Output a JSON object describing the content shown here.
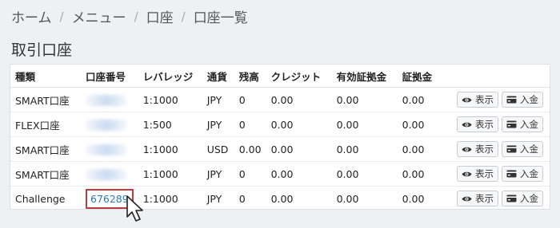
{
  "breadcrumb": {
    "items": [
      "ホーム",
      "メニュー",
      "口座",
      "口座一覧"
    ],
    "separator": "/"
  },
  "page_title": "取引口座",
  "table": {
    "headers": [
      "種類",
      "口座番号",
      "レバレッジ",
      "通貨",
      "残高",
      "クレジット",
      "有効証拠金",
      "証拠金"
    ],
    "rows": [
      {
        "type": "SMART口座",
        "account": "",
        "leverage": "1:1000",
        "currency": "JPY",
        "balance": "0",
        "credit": "0.00",
        "equity": "0.00",
        "margin": "0.00"
      },
      {
        "type": "FLEX口座",
        "account": "",
        "leverage": "1:500",
        "currency": "JPY",
        "balance": "0",
        "credit": "0.00",
        "equity": "0.00",
        "margin": "0.00"
      },
      {
        "type": "SMART口座",
        "account": "",
        "leverage": "1:1000",
        "currency": "USD",
        "balance": "0.00",
        "credit": "0.00",
        "equity": "0.00",
        "margin": "0.00"
      },
      {
        "type": "SMART口座",
        "account": "",
        "leverage": "1:1000",
        "currency": "JPY",
        "balance": "0",
        "credit": "0.00",
        "equity": "0.00",
        "margin": "0.00"
      },
      {
        "type": "Challenge",
        "account": "676289",
        "leverage": "1:1000",
        "currency": "JPY",
        "balance": "0",
        "credit": "0.00",
        "equity": "0.00",
        "margin": "0.00"
      }
    ],
    "view_label": "表示",
    "deposit_label": "入金"
  },
  "colors": {
    "link": "#2a7ab8",
    "highlight_border": "#c0393b",
    "background": "#eef1f4"
  },
  "icons": {
    "view": "eye-icon",
    "deposit": "credit-card-icon",
    "pointer": "mouse-pointer-icon"
  }
}
